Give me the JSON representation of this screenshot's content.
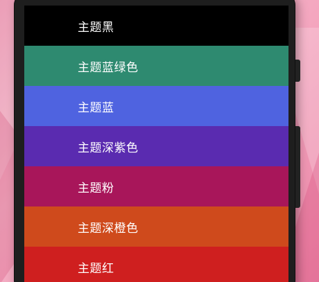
{
  "themes": [
    {
      "label": "主题黑",
      "color": "#000000"
    },
    {
      "label": "主题蓝绿色",
      "color": "#2e8a70"
    },
    {
      "label": "主题蓝",
      "color": "#4f63e0"
    },
    {
      "label": "主题深紫色",
      "color": "#5a2bb0"
    },
    {
      "label": "主题粉",
      "color": "#a8165a"
    },
    {
      "label": "主题深橙色",
      "color": "#cf4a1c"
    },
    {
      "label": "主题红",
      "color": "#cf1f1f"
    }
  ]
}
